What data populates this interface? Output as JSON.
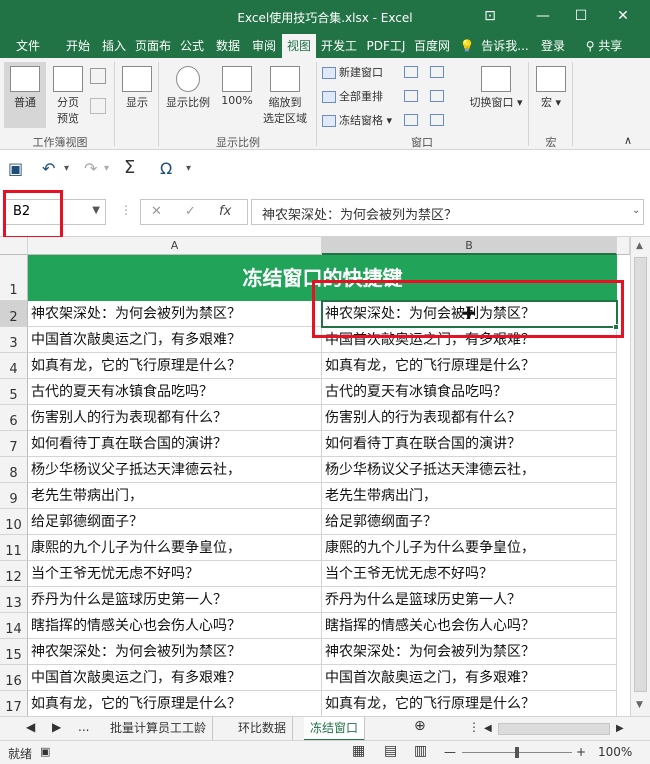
{
  "window": {
    "title": "Excel使用技巧合集.xlsx - Excel",
    "controls": [
      "⊡",
      "—",
      "☐",
      "✕"
    ]
  },
  "ribbon_tabs": [
    {
      "label": "文件",
      "active": false
    },
    {
      "label": "开始",
      "active": false
    },
    {
      "label": "插入",
      "active": false
    },
    {
      "label": "页面布",
      "active": false
    },
    {
      "label": "公式",
      "active": false
    },
    {
      "label": "数据",
      "active": false
    },
    {
      "label": "审阅",
      "active": false
    },
    {
      "label": "视图",
      "active": true
    },
    {
      "label": "开发工",
      "active": false
    },
    {
      "label": "PDF工J",
      "active": false
    },
    {
      "label": "百度网",
      "active": false
    },
    {
      "label": "告诉我...",
      "active": false
    },
    {
      "label": "登录",
      "active": false
    },
    {
      "label": "共享",
      "active": false
    }
  ],
  "ribbon": {
    "normal": "普通",
    "page_break_line1": "分页",
    "page_break_line2": "预览",
    "show": "显示",
    "zoom": "显示比例",
    "zoom100": "100%",
    "zoom_sel_line1": "缩放到",
    "zoom_sel_line2": "选定区域",
    "new_window": "新建窗口",
    "arrange_all": "全部重排",
    "freeze_panes": "冻结窗格",
    "switch_window": "切换窗口",
    "macros": "宏",
    "group_workbook_views": "工作簿视图",
    "group_zoom": "显示比例",
    "group_window": "窗口",
    "group_macros": "宏"
  },
  "formula_bar": {
    "name_box": "B2",
    "fx_label": "fx",
    "formula": "神农架深处：为何会被列为禁区？"
  },
  "columns": [
    "A",
    "B"
  ],
  "title_row": {
    "row": "1",
    "text": "冻结窗口的快捷键"
  },
  "rows": [
    {
      "row": "2",
      "a": "神农架深处：为何会被列为禁区？",
      "b": "神农架深处：为何会被列为禁区？"
    },
    {
      "row": "3",
      "a": "中国首次敲奥运之门，有多艰难？",
      "b": "中国首次敲奥运之门，有多艰难？"
    },
    {
      "row": "4",
      "a": "如真有龙，它的飞行原理是什么？",
      "b": "如真有龙，它的飞行原理是什么？"
    },
    {
      "row": "5",
      "a": "古代的夏天有冰镇食品吃吗？",
      "b": "古代的夏天有冰镇食品吃吗？"
    },
    {
      "row": "6",
      "a": "伤害别人的行为表现都有什么？",
      "b": "伤害别人的行为表现都有什么？"
    },
    {
      "row": "7",
      "a": "如何看待丁真在联合国的演讲？",
      "b": "如何看待丁真在联合国的演讲？"
    },
    {
      "row": "8",
      "a": "杨少华杨议父子抵达天津德云社，",
      "b": "杨少华杨议父子抵达天津德云社，"
    },
    {
      "row": "9",
      "a": "老先生带病出门，",
      "b": "老先生带病出门，"
    },
    {
      "row": "10",
      "a": "给足郭德纲面子？",
      "b": "给足郭德纲面子？"
    },
    {
      "row": "11",
      "a": "康熙的九个儿子为什么要争皇位，",
      "b": "康熙的九个儿子为什么要争皇位，"
    },
    {
      "row": "12",
      "a": "当个王爷无忧无虑不好吗？",
      "b": "当个王爷无忧无虑不好吗？"
    },
    {
      "row": "13",
      "a": "乔丹为什么是篮球历史第一人？",
      "b": "乔丹为什么是篮球历史第一人？"
    },
    {
      "row": "14",
      "a": "瞎指挥的情感关心也会伤人心吗？",
      "b": "瞎指挥的情感关心也会伤人心吗？"
    },
    {
      "row": "15",
      "a": "神农架深处：为何会被列为禁区？",
      "b": "神农架深处：为何会被列为禁区？"
    },
    {
      "row": "16",
      "a": "中国首次敲奥运之门，有多艰难？",
      "b": "中国首次敲奥运之门，有多艰难？"
    },
    {
      "row": "17",
      "a": "如真有龙，它的飞行原理是什么？",
      "b": "如真有龙，它的飞行原理是什么？"
    }
  ],
  "sheet_tabs": [
    {
      "label": "批量计算员工工龄",
      "active": false
    },
    {
      "label": "环比数据",
      "active": false
    },
    {
      "label": "冻结窗口",
      "active": true
    }
  ],
  "sheet_nav": {
    "ellipsis": "..."
  },
  "status": {
    "ready": "就绪",
    "zoom": "100%"
  },
  "colors": {
    "excel_green": "#217346",
    "title_fill": "#22a35a",
    "highlight_red": "#e81123"
  }
}
